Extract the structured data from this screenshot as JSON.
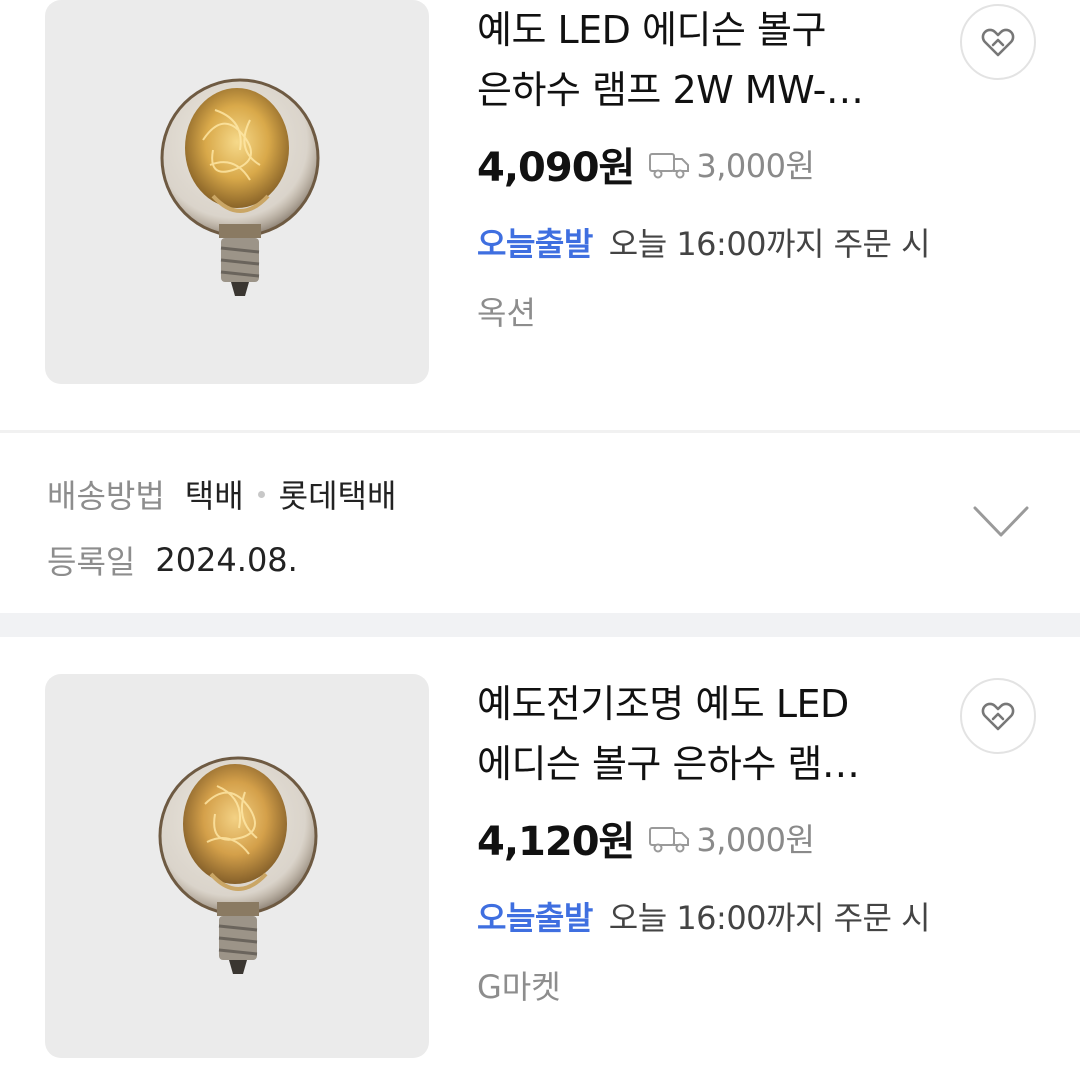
{
  "products": [
    {
      "title_line1": "예도 LED 에디슨 볼구",
      "title_line2": "은하수 램프 2W MW-…",
      "price": "4,090원",
      "shipping": "3,000원",
      "delivery_badge": "오늘출발",
      "delivery_text": "오늘 16:00까지 주문 시",
      "store": "옥션",
      "image_icon": "edison-bulb-image",
      "favorite_icon": "heart-tag-icon",
      "shipping_icon": "truck-icon"
    },
    {
      "title_line1": "예도전기조명 예도 LED",
      "title_line2": "에디슨 볼구 은하수 램…",
      "price": "4,120원",
      "shipping": "3,000원",
      "delivery_badge": "오늘출발",
      "delivery_text": "오늘 16:00까지 주문 시",
      "store": "G마켓",
      "image_icon": "edison-bulb-image",
      "favorite_icon": "heart-tag-icon",
      "shipping_icon": "truck-icon"
    }
  ],
  "shipping_info": {
    "method_label": "배송방법",
    "method_value_1": "택배",
    "method_value_2": "롯데택배",
    "date_label": "등록일",
    "date_value": "2024.08.",
    "expand_icon": "chevron-down-icon"
  },
  "colors": {
    "accent_blue": "#3f6fe0",
    "muted_text": "#8d8d8d",
    "thumb_bg": "#ebebeb",
    "divider": "#f1f2f4"
  }
}
